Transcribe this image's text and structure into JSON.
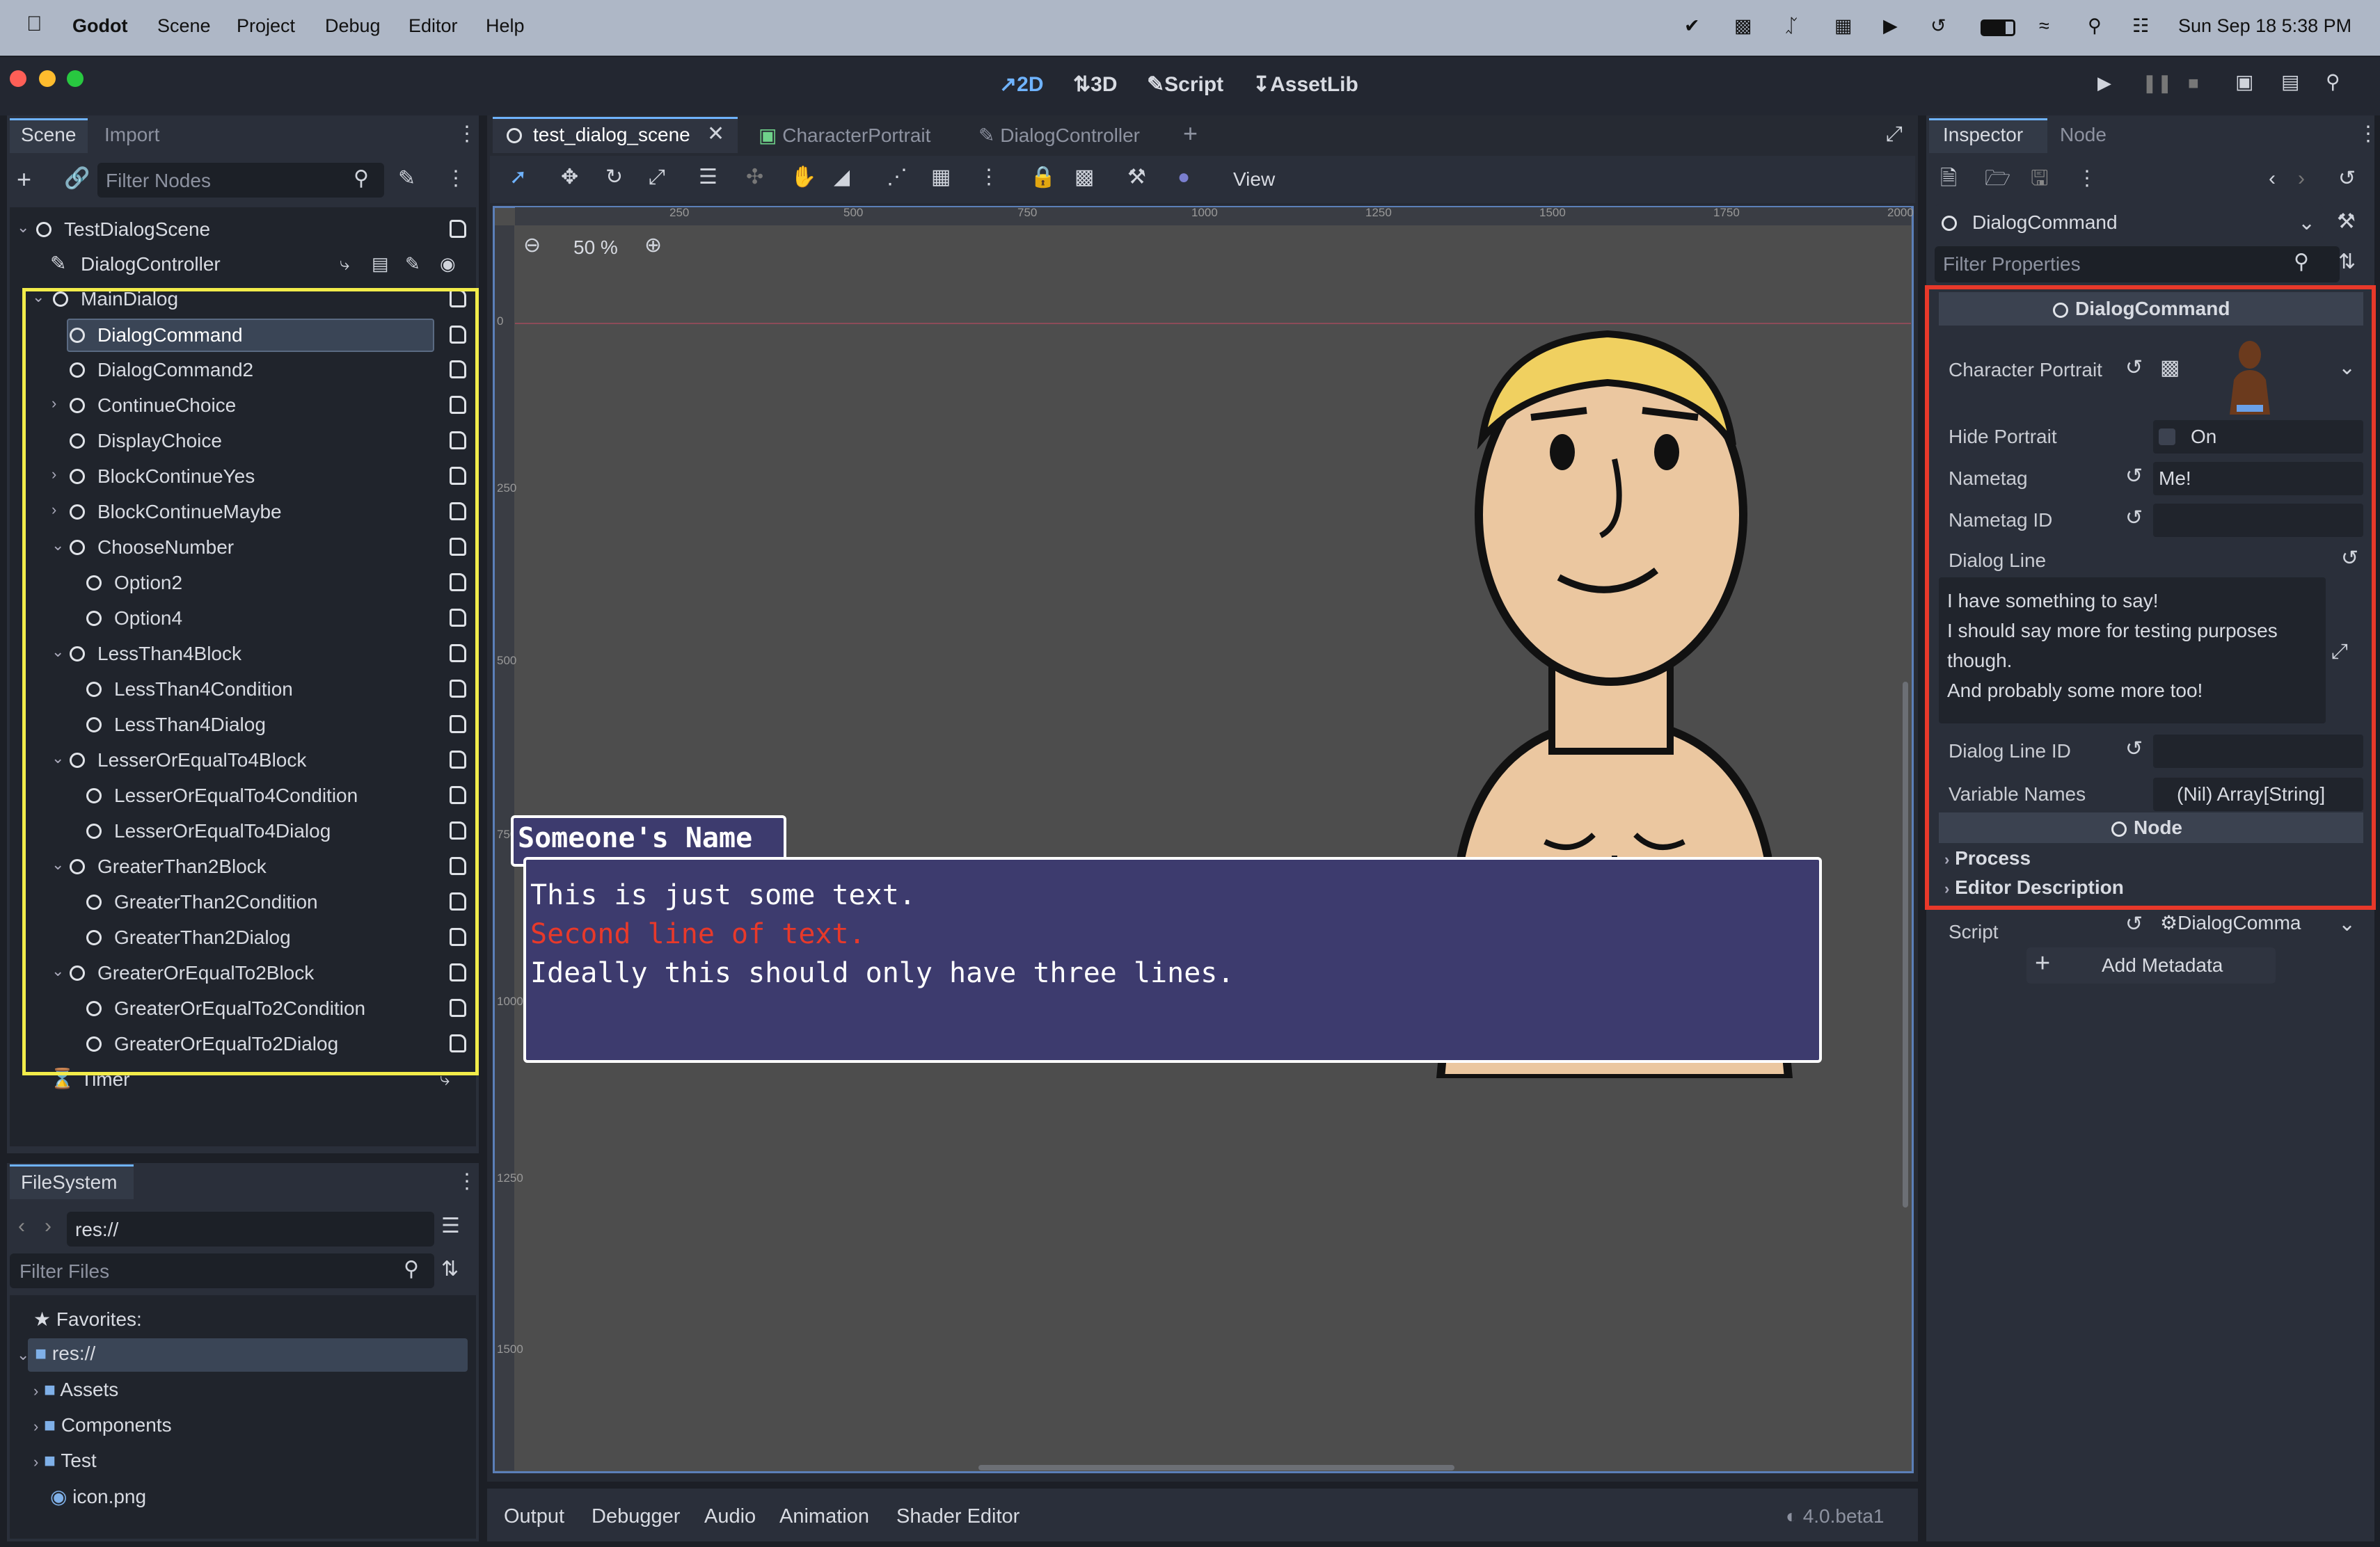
{
  "menubar": {
    "app": "Godot",
    "items": [
      "Scene",
      "Project",
      "Debug",
      "Editor",
      "Help"
    ],
    "clock": "Sun Sep 18  5:38 PM"
  },
  "toolbar": {
    "workspaces": [
      "2D",
      "3D",
      "Script",
      "AssetLib"
    ]
  },
  "scene_dock": {
    "tabs": [
      "Scene",
      "Import"
    ],
    "filter_placeholder": "Filter Nodes",
    "tree": [
      "TestDialogScene",
      "DialogController",
      "MainDialog",
      "DialogCommand",
      "DialogCommand2",
      "ContinueChoice",
      "DisplayChoice",
      "BlockContinueYes",
      "BlockContinueMaybe",
      "ChooseNumber",
      "Option2",
      "Option4",
      "LessThan4Block",
      "LessThan4Condition",
      "LessThan4Dialog",
      "LesserOrEqualTo4Block",
      "LesserOrEqualTo4Condition",
      "LesserOrEqualTo4Dialog",
      "GreaterThan2Block",
      "GreaterThan2Condition",
      "GreaterThan2Dialog",
      "GreaterOrEqualTo2Block",
      "GreaterOrEqualTo2Condition",
      "GreaterOrEqualTo2Dialog",
      "Timer"
    ]
  },
  "filesystem": {
    "title": "FileSystem",
    "path": "res://",
    "filter_placeholder": "Filter Files",
    "favorites": "Favorites:",
    "root": "res://",
    "items": [
      "Assets",
      "Components",
      "Test",
      "icon.png"
    ]
  },
  "editor": {
    "tabs": [
      "test_dialog_scene",
      "CharacterPortrait",
      "DialogController"
    ],
    "zoom": "50 %",
    "view_menu": "View",
    "ruler_top": [
      "250",
      "500",
      "750",
      "1000",
      "1250",
      "1500",
      "1750",
      "2000"
    ],
    "ruler_left": [
      "0",
      "250",
      "500",
      "750",
      "1000",
      "1250",
      "1500"
    ]
  },
  "dialog_box": {
    "nametag": "Someone's Name",
    "line1": "This is just some text.",
    "line2": "Second line of text.",
    "line3": "Ideally this should only have three lines."
  },
  "bottom_panel": {
    "tabs": [
      "Output",
      "Debugger",
      "Audio",
      "Animation",
      "Shader Editor"
    ],
    "version": "4.0.beta1"
  },
  "inspector": {
    "tabs": [
      "Inspector",
      "Node"
    ],
    "object": "DialogCommand",
    "filter_placeholder": "Filter Properties",
    "section": "DialogCommand",
    "props": {
      "character_portrait": "Character Portrait",
      "hide_portrait": "Hide Portrait",
      "hide_portrait_value": "On",
      "nametag": "Nametag",
      "nametag_value": "Me!",
      "nametag_id": "Nametag ID",
      "dialog_line": "Dialog Line",
      "dialog_line_value": [
        "I have something to say!",
        "I should say more for testing purposes",
        "though.",
        "And probably some more too!"
      ],
      "dialog_line_id": "Dialog Line ID",
      "variable_names": "Variable Names",
      "variable_names_value": "(Nil) Array[String]"
    },
    "node_section": "Node",
    "process": "Process",
    "editor_description": "Editor Description",
    "script_label": "Script",
    "script_value": "DialogComma",
    "add_metadata": "Add Metadata"
  },
  "colors": {
    "highlight_yellow": "#f2ec4a",
    "highlight_red": "#e8392a",
    "dialog_bg": "#3d3b6e",
    "accent": "#5fa8ff"
  }
}
